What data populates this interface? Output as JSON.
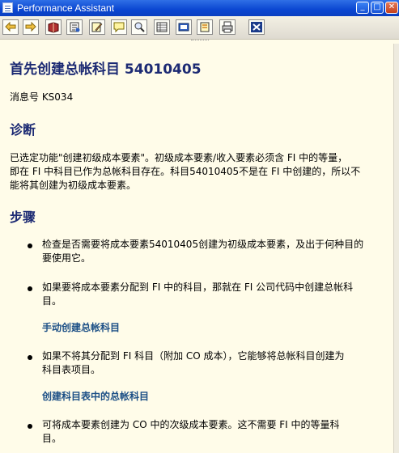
{
  "window": {
    "title": "Performance Assistant",
    "min_glyph": "_",
    "max_glyph": "□",
    "close_glyph": "✕"
  },
  "toolbar": {
    "buttons": [
      {
        "icon": "back-arrow-icon"
      },
      {
        "icon": "forward-arrow-icon"
      },
      {
        "icon": "book-icon"
      },
      {
        "icon": "technical-info-icon"
      },
      {
        "icon": "edit-note-icon"
      },
      {
        "icon": "remark-icon"
      },
      {
        "icon": "find-icon"
      },
      {
        "icon": "list-icon"
      },
      {
        "icon": "document-icon"
      },
      {
        "icon": "settings-icon"
      },
      {
        "icon": "print-icon"
      },
      {
        "icon": "close-icon"
      }
    ]
  },
  "document": {
    "heading": "首先创建总帐科目 54010405",
    "message_id": "消息号  KS034",
    "diagnosis_title": "诊断",
    "diagnosis_lines": [
      "已选定功能\"创建初级成本要素\"。初级成本要素/收入要素必须含 FI 中的等量，",
      "即在 FI 中科目已作为总帐科目存在。科目54010405不是在 FI 中创建的，所以不",
      "能将其创建为初级成本要素。"
    ],
    "procedure_title": "步骤",
    "steps": [
      {
        "lines": [
          "检查是否需要将成本要素54010405创建为初级成本要素，及出于何种目的",
          "要使用它。"
        ]
      },
      {
        "lines": [
          "如果要将成本要素分配到 FI 中的科目，那就在 FI 公司代码中创建总帐科",
          "目。"
        ]
      },
      {
        "lines": [
          "如果不将其分配到 FI 科目（附加 CO 成本），它能够将总帐科目创建为",
          "科目表项目。"
        ]
      },
      {
        "lines": [
          "可将成本要素创建为 CO 中的次级成本要素。这不需要 FI 中的等量科",
          "目。"
        ]
      }
    ],
    "links": {
      "create_gl": "手动创建总帐科目",
      "create_in_chart": "创建科目表中的总帐科目"
    }
  }
}
